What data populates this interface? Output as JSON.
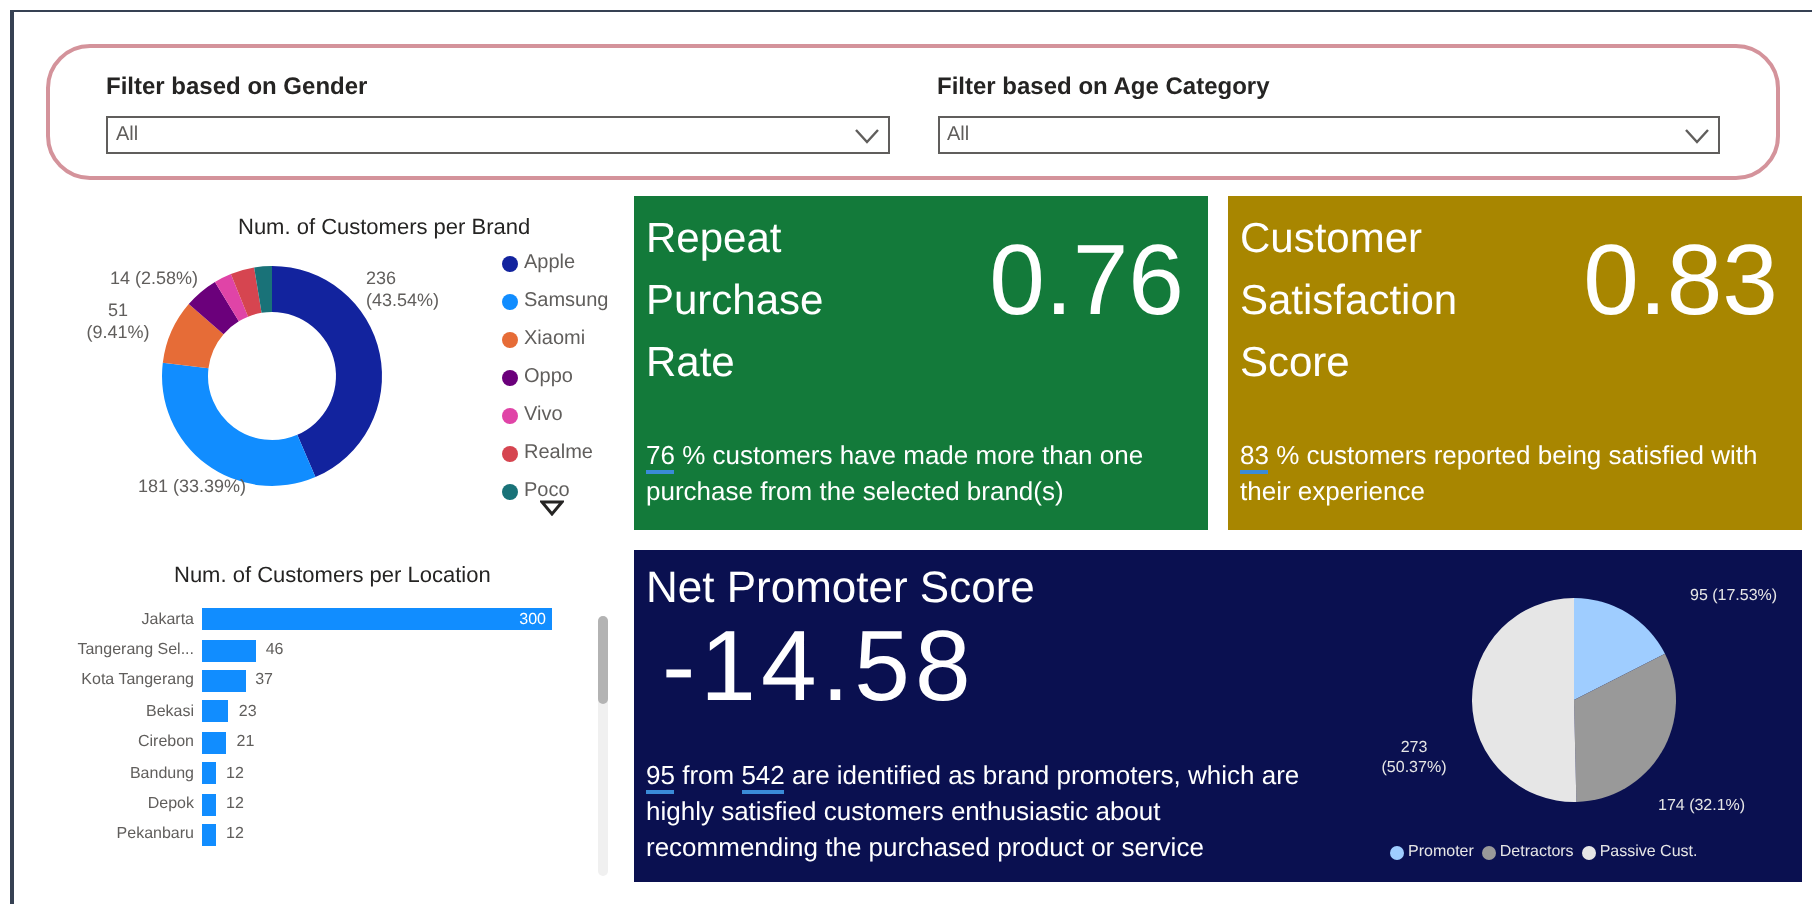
{
  "filters": [
    {
      "label": "Filter based on Gender",
      "value": "All"
    },
    {
      "label": "Filter based on Age Category",
      "value": "All"
    }
  ],
  "brand_chart": {
    "chart_data": {
      "type": "donut",
      "title": "Num. of Customers per Brand",
      "categories": [
        "Apple",
        "Samsung",
        "Xiaomi",
        "Oppo",
        "Vivo",
        "Realme",
        "Poco"
      ],
      "series": [
        {
          "values": [
            43.54,
            33.39,
            9.41,
            4.98,
            2.58,
            3.5,
            2.6
          ]
        }
      ],
      "legend": "right",
      "colors": [
        "#12239e",
        "#118dff",
        "#e66c37",
        "#6b007b",
        "#e044a7",
        "#d64550",
        "#197278"
      ],
      "value_labels": [
        "236 (43.54%)",
        "181 (33.39%)",
        "51 (9.41%)",
        null,
        "14 (2.58%)",
        null,
        null
      ]
    }
  },
  "location_chart": {
    "chart_data": {
      "type": "bar",
      "orientation": "horizontal",
      "title": "Num. of Customers per Location",
      "categories": [
        "Jakarta",
        "Tangerang Sel...",
        "Kota Tangerang",
        "Bekasi",
        "Cirebon",
        "Bandung",
        "Depok",
        "Pekanbaru"
      ],
      "series": [
        {
          "color": "#118dff",
          "values": [
            300,
            46,
            37,
            23,
            21,
            12,
            12,
            12
          ]
        }
      ],
      "data_labels": true
    }
  },
  "cards": [
    {
      "title": "Repeat Purchase Rate",
      "value": "0.76",
      "color": "#137a3a",
      "highlight": "76",
      "text": " % customers have made more than one purchase from the selected brand(s)"
    },
    {
      "title": "Customer Satisfaction Score",
      "value": "0.83",
      "color": "#a88600",
      "highlight": "83",
      "text": " % customers reported being satisfied with their experience"
    }
  ],
  "nps": {
    "title": "Net Promoter Score",
    "value": "-14.58",
    "promoters": "95",
    "total": "542",
    "text_mid": " from ",
    "text_end": " are identified as brand promoters, which are highly satisfied customers enthusiastic about recommending the purchased product or service",
    "chart_data": {
      "type": "pie",
      "categories": [
        "Promoter",
        "Detractors",
        "Passive Cust."
      ],
      "series": [
        {
          "values": [
            17.53,
            32.1,
            50.37
          ]
        }
      ],
      "legend": "bottom",
      "colors": [
        "#9fcdff",
        "#999999",
        "#e6e6e6"
      ],
      "value_labels": [
        "95 (17.53%)",
        "174 (32.1%)",
        "273 (50.37%)"
      ]
    }
  }
}
